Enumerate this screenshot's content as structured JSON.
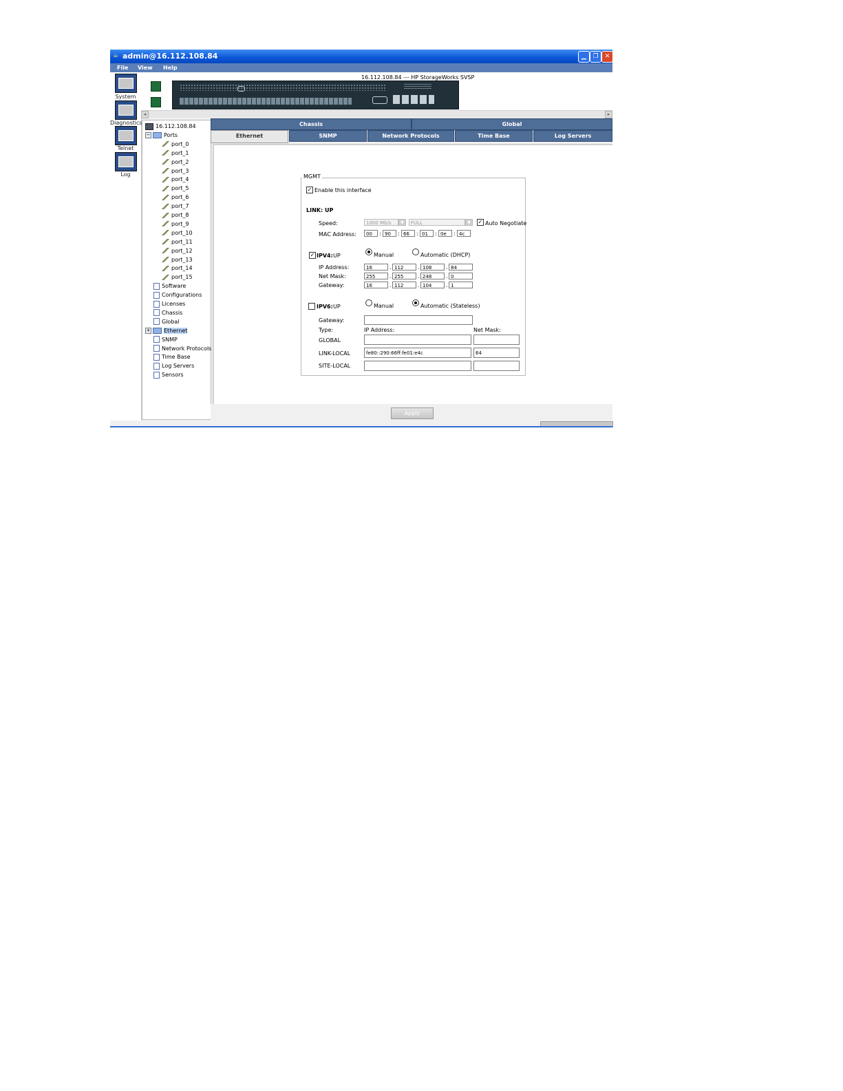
{
  "window": {
    "title": "admin@16.112.108.84"
  },
  "menu": [
    "File",
    "View",
    "Help"
  ],
  "left_nav": [
    {
      "label": "System",
      "icon": "system-icon"
    },
    {
      "label": "Diagnostics",
      "icon": "diagnostics-icon"
    },
    {
      "label": "Telnet",
      "icon": "telnet-icon"
    },
    {
      "label": "Log",
      "icon": "log-icon"
    }
  ],
  "device": {
    "title": "16.112.108.84 --- HP StorageWorks SVSP"
  },
  "tree": {
    "root": "16.112.108.84",
    "ports_label": "Ports",
    "ports": [
      "port_0",
      "port_1",
      "port_2",
      "port_3",
      "port_4",
      "port_5",
      "port_6",
      "port_7",
      "port_8",
      "port_9",
      "port_10",
      "port_11",
      "port_12",
      "port_13",
      "port_14",
      "port_15"
    ],
    "items_before": [
      "Software",
      "Configurations",
      "Licenses",
      "Chassis",
      "Global"
    ],
    "selected": "Ethernet",
    "items_after": [
      "SNMP",
      "Network Protocols",
      "Time Base",
      "Log Servers",
      "Sensors"
    ]
  },
  "tabs_top": [
    "Chassis",
    "Global"
  ],
  "tabs_sub": [
    "Ethernet",
    "SNMP",
    "Network Protocols",
    "Time Base",
    "Log Servers"
  ],
  "active_sub_tab": "Ethernet",
  "form": {
    "group_title": "MGMT",
    "enable_label": "Enable this interface",
    "enable_checked": true,
    "link_status": "LINK: UP",
    "speed_label": "Speed:",
    "speed_value": "1000 Mb/s",
    "duplex_value": "FULL",
    "auto_negotiate_label": "Auto Negotiate",
    "auto_negotiate_checked": true,
    "mac_label": "MAC Address:",
    "mac": [
      "00",
      "90",
      "66",
      "01",
      "0e",
      "4c"
    ],
    "ipv4_label": "IPV4:",
    "ipv4_status": "UP",
    "ipv4_checked": true,
    "ipv4_manual_label": "Manual",
    "ipv4_auto_label": "Automatic (DHCP)",
    "ipv4_mode": "Manual",
    "ip_label": "IP Address:",
    "ip": [
      "16",
      "112",
      "108",
      "84"
    ],
    "netmask_label": "Net Mask:",
    "netmask": [
      "255",
      "255",
      "248",
      "0"
    ],
    "gateway_label": "Gateway:",
    "gateway": [
      "16",
      "112",
      "104",
      "1"
    ],
    "ipv6_label": "IPV6:",
    "ipv6_status": "UP",
    "ipv6_checked": false,
    "ipv6_manual_label": "Manual",
    "ipv6_auto_label": "Automatic (Stateless)",
    "ipv6_mode": "Automatic (Stateless)",
    "ipv6_gateway_label": "Gateway:",
    "ipv6_gateway_value": "",
    "type_label": "Type:",
    "ip_address_col": "IP Address:",
    "netmask_col": "Net Mask:",
    "rows": [
      {
        "type": "GLOBAL",
        "address": "",
        "mask": ""
      },
      {
        "type": "LINK-LOCAL",
        "address": "fe80::290:66ff:fe01:e4c",
        "mask": "64"
      },
      {
        "type": "SITE-LOCAL",
        "address": "",
        "mask": ""
      }
    ]
  },
  "apply_label": "Apply"
}
